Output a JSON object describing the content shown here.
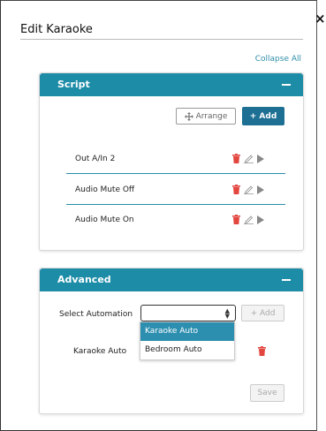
{
  "modal": {
    "title": "Edit Karaoke",
    "close_glyph": "×",
    "collapse_all": "Collapse All"
  },
  "script_panel": {
    "title": "Script",
    "arrange_label": "Arrange",
    "add_label": "+ Add",
    "rows": [
      {
        "label": "Out A/In 2"
      },
      {
        "label": "Audio Mute Off"
      },
      {
        "label": "Audio Mute On"
      }
    ]
  },
  "advanced_panel": {
    "title": "Advanced",
    "select_label": "Select Automation",
    "select_value": "",
    "add_label": "+ Add",
    "options": [
      "Karaoke Auto",
      "Bedroom Auto"
    ],
    "highlighted_option": "Karaoke Auto",
    "automation_item": "Karaoke Auto",
    "save_label": "Save"
  },
  "colors": {
    "header": "#1d8ca7",
    "primary_button": "#1d6f93",
    "trash": "#e2463f",
    "link": "#2e8fa8"
  },
  "icons": [
    "close-icon",
    "collapse-icon",
    "move-icon",
    "trash-icon",
    "pencil-icon",
    "play-icon",
    "select-arrows-icon"
  ]
}
